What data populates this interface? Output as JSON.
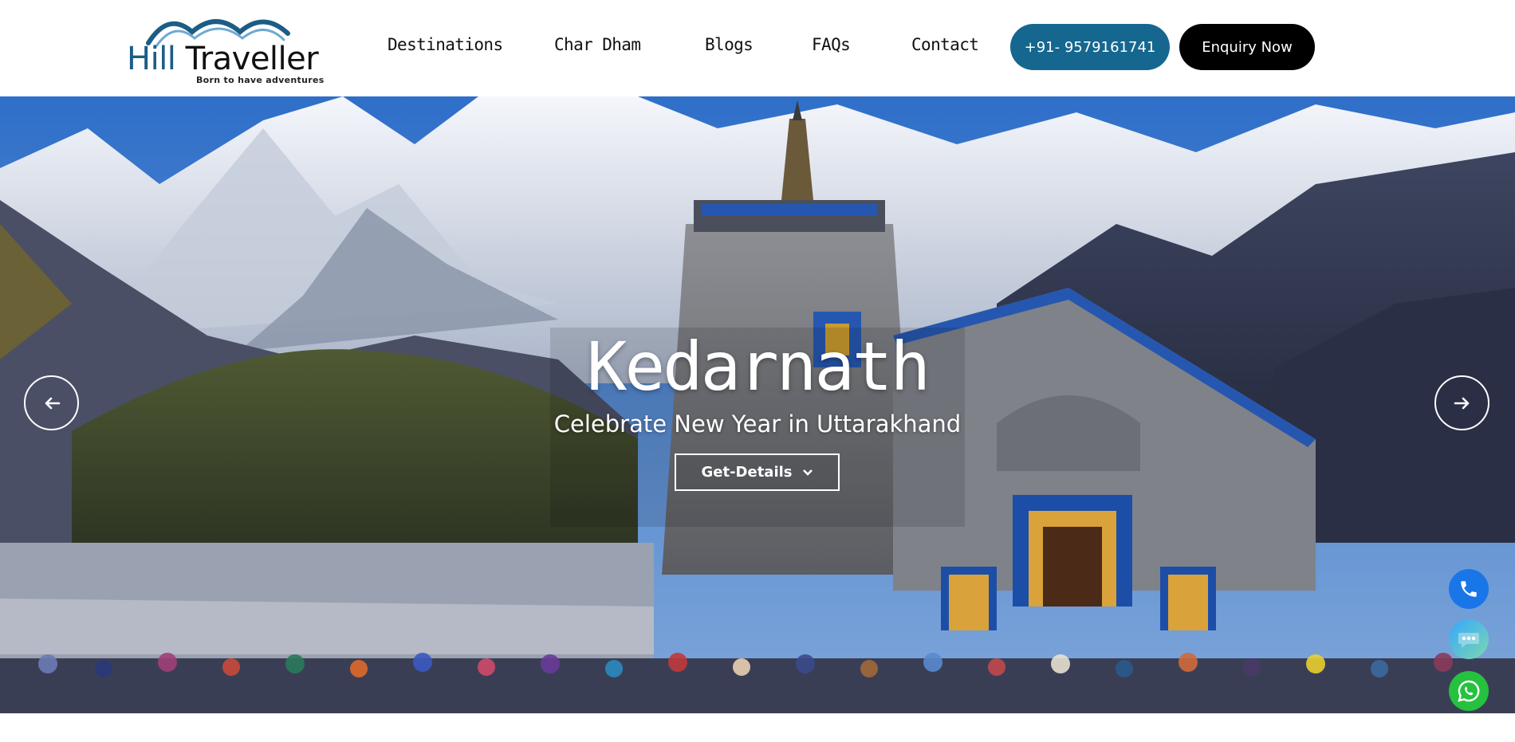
{
  "logo": {
    "name_part1": "Hill",
    "name_part2": "Traveller",
    "tagline": "Born to have adventures",
    "colors": {
      "primary": "#1c5d86",
      "dark": "#111111"
    }
  },
  "nav": {
    "items": [
      {
        "label": "Destinations"
      },
      {
        "label": "Char Dham"
      },
      {
        "label": "Blogs"
      },
      {
        "label": "FAQs"
      },
      {
        "label": "Contact"
      }
    ],
    "phone_label": "+91- 9579161741",
    "enquiry_label": "Enquiry Now",
    "colors": {
      "phone_button": "#15678f",
      "enquiry_button": "#000000"
    }
  },
  "hero": {
    "title": "Kedarnath",
    "subtitle": "Celebrate New Year in Uttarakhand",
    "cta_label": "Get-Details",
    "cta_icon": "chevron-down-icon",
    "prev_icon": "arrow-left-icon",
    "next_icon": "arrow-right-icon"
  },
  "floating": {
    "call_icon": "phone-icon",
    "chat_icon": "chat-icon",
    "whatsapp_icon": "whatsapp-icon",
    "colors": {
      "call": "#1976e8",
      "whatsapp": "#25c13f"
    }
  }
}
